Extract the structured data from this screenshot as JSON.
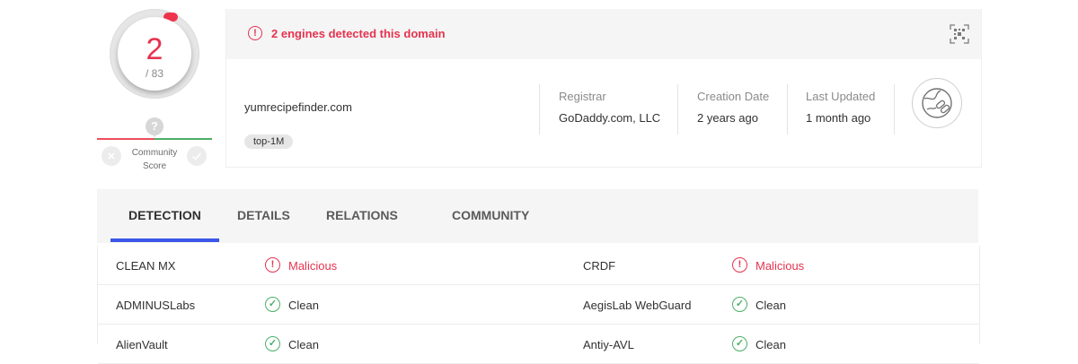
{
  "score": {
    "detections": "2",
    "total": "/ 83",
    "community_label_line1": "Community",
    "community_label_line2": "Score",
    "community_unknown_glyph": "?",
    "accent_color": "#e6334f"
  },
  "summary": {
    "alert_text": "2 engines detected this domain",
    "domain": "yumrecipefinder.com",
    "tag": "top-1M",
    "registrar_label": "Registrar",
    "registrar_value": "GoDaddy.com, LLC",
    "creation_label": "Creation Date",
    "creation_value": "2 years ago",
    "updated_label": "Last Updated",
    "updated_value": "1 month ago"
  },
  "tabs": [
    {
      "label": "DETECTION",
      "active": true
    },
    {
      "label": "DETAILS",
      "active": false
    },
    {
      "label": "RELATIONS",
      "active": false
    },
    {
      "label": "COMMUNITY",
      "active": false
    }
  ],
  "detections": [
    {
      "left": {
        "engine": "CLEAN MX",
        "verdict": "Malicious",
        "status": "malicious"
      },
      "right": {
        "engine": "CRDF",
        "verdict": "Malicious",
        "status": "malicious"
      }
    },
    {
      "left": {
        "engine": "ADMINUSLabs",
        "verdict": "Clean",
        "status": "clean"
      },
      "right": {
        "engine": "AegisLab WebGuard",
        "verdict": "Clean",
        "status": "clean"
      }
    },
    {
      "left": {
        "engine": "AlienVault",
        "verdict": "Clean",
        "status": "clean"
      },
      "right": {
        "engine": "Antiy-AVL",
        "verdict": "Clean",
        "status": "clean"
      }
    }
  ],
  "icons": {
    "alert": "alert-circle-icon",
    "qr": "qr-scan-icon",
    "globe": "globe-link-icon",
    "malicious": "alert-circle-icon",
    "clean": "check-circle-icon"
  },
  "colors": {
    "malicious": "#e6334f",
    "clean": "#4caf67",
    "tab_active_underline": "#3b56e8"
  }
}
